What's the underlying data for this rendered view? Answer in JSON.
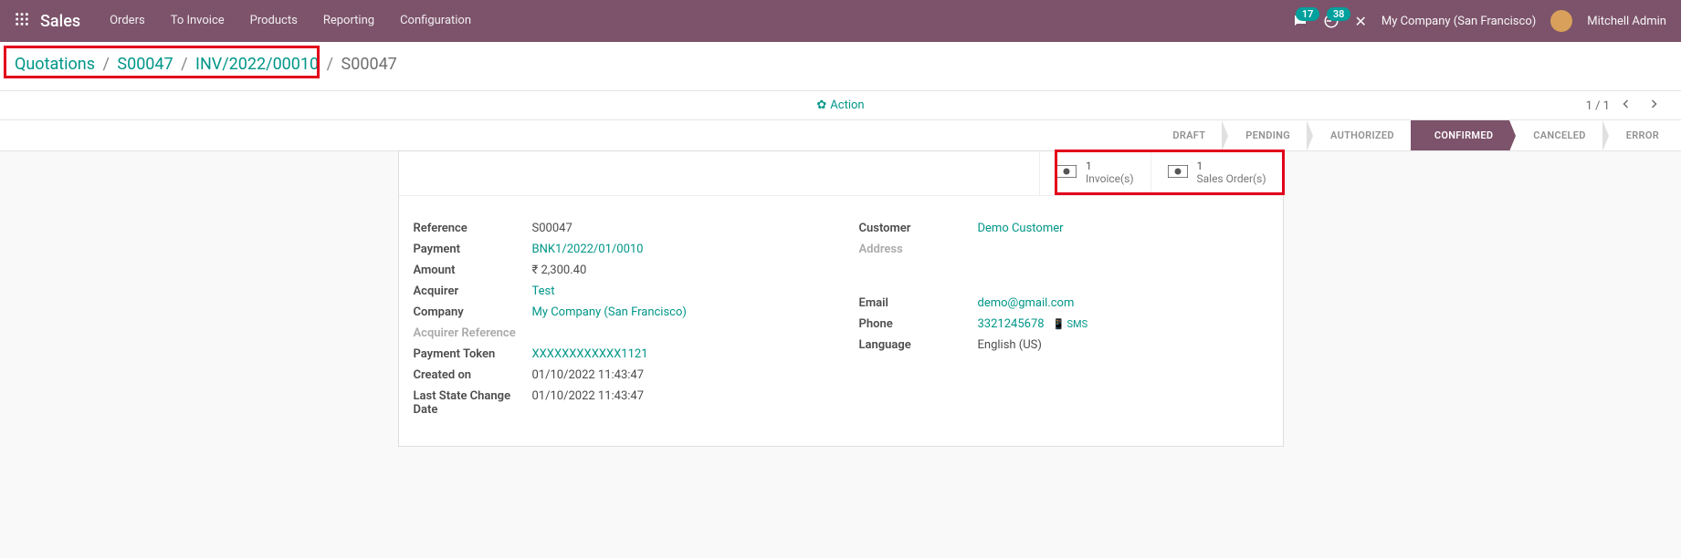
{
  "topnav": {
    "brand": "Sales",
    "menu": [
      "Orders",
      "To Invoice",
      "Products",
      "Reporting",
      "Configuration"
    ],
    "chat_count": "17",
    "activity_count": "38",
    "company": "My Company (San Francisco)",
    "user": "Mitchell Admin"
  },
  "breadcrumbs": {
    "items": [
      "Quotations",
      "S00047",
      "INV/2022/00010"
    ],
    "current": "S00047"
  },
  "action_label": "Action",
  "pager": {
    "position": "1 / 1"
  },
  "statusbar": {
    "states": [
      "DRAFT",
      "PENDING",
      "AUTHORIZED",
      "CONFIRMED",
      "CANCELED",
      "ERROR"
    ],
    "active_index": 3
  },
  "stat_buttons": {
    "invoices": {
      "count": "1",
      "label": "Invoice(s)"
    },
    "sales_orders": {
      "count": "1",
      "label": "Sales Order(s)"
    }
  },
  "left_fields": {
    "reference": {
      "label": "Reference",
      "value": "S00047"
    },
    "payment": {
      "label": "Payment",
      "value": "BNK1/2022/01/0010"
    },
    "amount": {
      "label": "Amount",
      "value": "₹ 2,300.40"
    },
    "acquirer": {
      "label": "Acquirer",
      "value": "Test"
    },
    "company": {
      "label": "Company",
      "value": "My Company (San Francisco)"
    },
    "acquirer_reference": {
      "label": "Acquirer Reference",
      "value": ""
    },
    "payment_token": {
      "label": "Payment Token",
      "value": "XXXXXXXXXXXX1121"
    },
    "created_on": {
      "label": "Created on",
      "value": "01/10/2022 11:43:47"
    },
    "last_state_change": {
      "label": "Last State Change Date",
      "value": "01/10/2022 11:43:47"
    }
  },
  "right_fields": {
    "customer": {
      "label": "Customer",
      "value": "Demo Customer"
    },
    "address": {
      "label": "Address",
      "value": ""
    },
    "email": {
      "label": "Email",
      "value": "demo@gmail.com"
    },
    "phone": {
      "label": "Phone",
      "value": "3321245678",
      "sms": "SMS"
    },
    "language": {
      "label": "Language",
      "value": "English (US)"
    }
  }
}
